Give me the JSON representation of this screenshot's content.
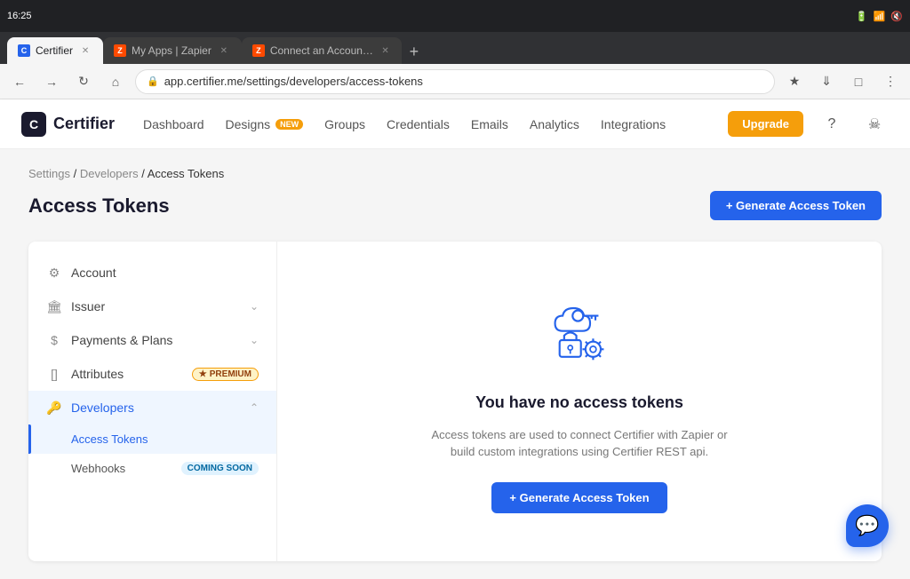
{
  "browser": {
    "time": "16:25",
    "url": "app.certifier.me/settings/developers/access-tokens",
    "tabs": [
      {
        "id": "certifier",
        "label": "Certifier",
        "favicon_color": "#2563eb",
        "active": true
      },
      {
        "id": "zapier-apps",
        "label": "My Apps | Zapier",
        "favicon_color": "#ff4a00",
        "active": false
      },
      {
        "id": "zapier-connect",
        "label": "Connect an Account | Zapier",
        "favicon_color": "#ff4a00",
        "active": false
      }
    ]
  },
  "navbar": {
    "brand": "Certifier",
    "links": [
      {
        "id": "dashboard",
        "label": "Dashboard",
        "badge": null
      },
      {
        "id": "designs",
        "label": "Designs",
        "badge": "NEW"
      },
      {
        "id": "groups",
        "label": "Groups",
        "badge": null
      },
      {
        "id": "credentials",
        "label": "Credentials",
        "badge": null
      },
      {
        "id": "emails",
        "label": "Emails",
        "badge": null
      },
      {
        "id": "analytics",
        "label": "Analytics",
        "badge": null
      },
      {
        "id": "integrations",
        "label": "Integrations",
        "badge": null
      }
    ],
    "upgrade_label": "Upgrade"
  },
  "breadcrumb": {
    "parts": [
      "Settings",
      "Developers",
      "Access Tokens"
    ],
    "separator": "/"
  },
  "page": {
    "title": "Access Tokens",
    "generate_btn": "+ Generate Access Token"
  },
  "sidebar": {
    "items": [
      {
        "id": "account",
        "label": "Account",
        "icon": "gear",
        "has_chevron": false,
        "badge": null,
        "active": false
      },
      {
        "id": "issuer",
        "label": "Issuer",
        "icon": "building",
        "has_chevron": true,
        "badge": null,
        "active": false
      },
      {
        "id": "payments",
        "label": "Payments & Plans",
        "icon": "dollar",
        "has_chevron": true,
        "badge": null,
        "active": false
      },
      {
        "id": "attributes",
        "label": "Attributes",
        "icon": "brackets",
        "has_chevron": false,
        "badge": "PREMIUM",
        "active": false
      },
      {
        "id": "developers",
        "label": "Developers",
        "icon": "key",
        "has_chevron": true,
        "badge": null,
        "active": true
      }
    ],
    "sub_items": [
      {
        "id": "access-tokens",
        "label": "Access Tokens",
        "active": true,
        "badge": null
      },
      {
        "id": "webhooks",
        "label": "Webhooks",
        "active": false,
        "badge": "COMING SOON"
      }
    ]
  },
  "empty_state": {
    "title": "You have no access tokens",
    "description": "Access tokens are used to connect Certifier with Zapier or build custom integrations using Certifier REST api.",
    "generate_btn": "+ Generate Access Token"
  }
}
